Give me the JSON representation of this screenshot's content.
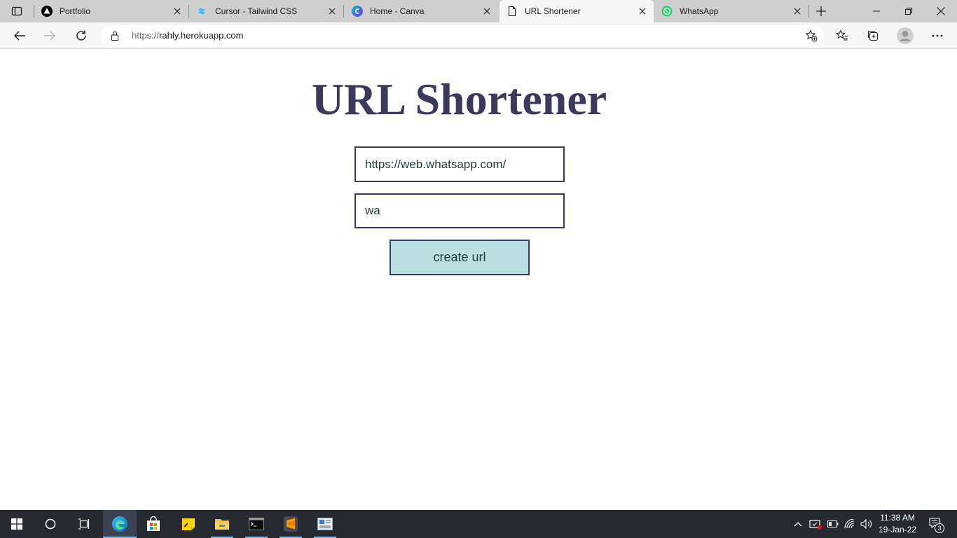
{
  "browser": {
    "tabs": [
      {
        "title": "Portfolio",
        "icon": "vercel-triangle-icon"
      },
      {
        "title": "Cursor - Tailwind CSS",
        "icon": "tailwind-icon"
      },
      {
        "title": "Home - Canva",
        "icon": "canva-icon"
      },
      {
        "title": "URL Shortener",
        "icon": "page-icon",
        "active": true
      },
      {
        "title": "WhatsApp",
        "icon": "whatsapp-icon"
      }
    ],
    "address": {
      "scheme": "https://",
      "host": "rahly.herokuapp.com"
    }
  },
  "page": {
    "title": "URL Shortener",
    "long_url_value": "https://web.whatsapp.com/",
    "short_name_value": "wa",
    "create_label": "create url",
    "colors": {
      "title": "#3b3a5c",
      "button_bg": "#bce0e2",
      "border": "#3b3a5c"
    }
  },
  "taskbar": {
    "apps": [
      "start",
      "cortana",
      "task-view",
      "edge",
      "store",
      "sticky-notes",
      "file-explorer",
      "terminal",
      "sublime-text",
      "news"
    ],
    "clock_time": "11:38 AM",
    "clock_date": "19-Jan-22",
    "notification_count": "3"
  }
}
